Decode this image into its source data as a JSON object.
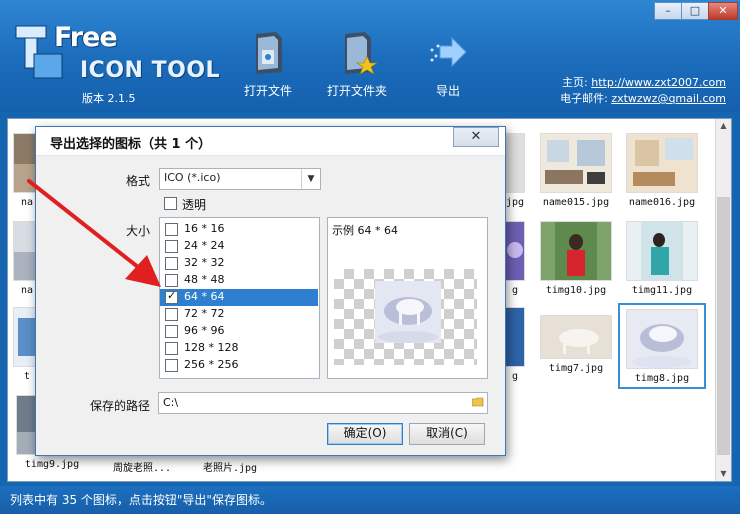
{
  "window": {
    "minimize_icon": "minimize-icon",
    "maximize_icon": "maximize-icon",
    "close_icon": "close-icon"
  },
  "header": {
    "logo_free": "Free",
    "logo_name": "ICON TOOL",
    "version": "版本 2.1.5",
    "toolbar": {
      "open_file": "打开文件",
      "open_folder": "打开文件夹",
      "export": "导出"
    },
    "contact": {
      "home_label": "主页:",
      "home_url": "http://www.zxt2007.com",
      "mail_label": "电子邮件:",
      "mail_address": "zxtwzwz@qmail.com"
    }
  },
  "list": {
    "items": [
      {
        "caption": "na"
      },
      {
        "caption": "na"
      },
      {
        "caption": "t"
      },
      {
        "caption": "timg9.jpg"
      },
      {
        "caption": "周旋老照..."
      },
      {
        "caption": "老照片.jpg"
      },
      {
        "caption": "jpg"
      },
      {
        "caption": "name015.jpg"
      },
      {
        "caption": "name016.jpg"
      },
      {
        "caption": "g"
      },
      {
        "caption": "timg10.jpg"
      },
      {
        "caption": "timg11.jpg"
      },
      {
        "caption": "g"
      },
      {
        "caption": "timg7.jpg"
      },
      {
        "caption": "timg8.jpg"
      }
    ]
  },
  "status": {
    "text": "列表中有 35 个图标，点击按钮\"导出\"保存图标。"
  },
  "dialog": {
    "title": "导出选择的图标（共 1 个）",
    "close": "✕",
    "format_label": "格式",
    "format_value": "ICO (*.ico)",
    "transparent_label": "透明",
    "transparent_checked": false,
    "size_label": "大小",
    "sizes": [
      {
        "label": "16 * 16",
        "checked": false
      },
      {
        "label": "24 * 24",
        "checked": false
      },
      {
        "label": "32 * 32",
        "checked": false
      },
      {
        "label": "48 * 48",
        "checked": false
      },
      {
        "label": "64 * 64",
        "checked": true
      },
      {
        "label": "72 * 72",
        "checked": false
      },
      {
        "label": "96 * 96",
        "checked": false
      },
      {
        "label": "128 * 128",
        "checked": false
      },
      {
        "label": "256 * 256",
        "checked": false
      }
    ],
    "selected_size_index": 4,
    "preview_label": "示例 64 * 64",
    "path_label": "保存的路径",
    "path_value": "C:\\",
    "ok_label": "确定(O)",
    "cancel_label": "取消(C)"
  },
  "colors": {
    "header_blue": "#1b6cbb",
    "selection_blue": "#2f7fd0",
    "annotation_red": "#e02020"
  }
}
